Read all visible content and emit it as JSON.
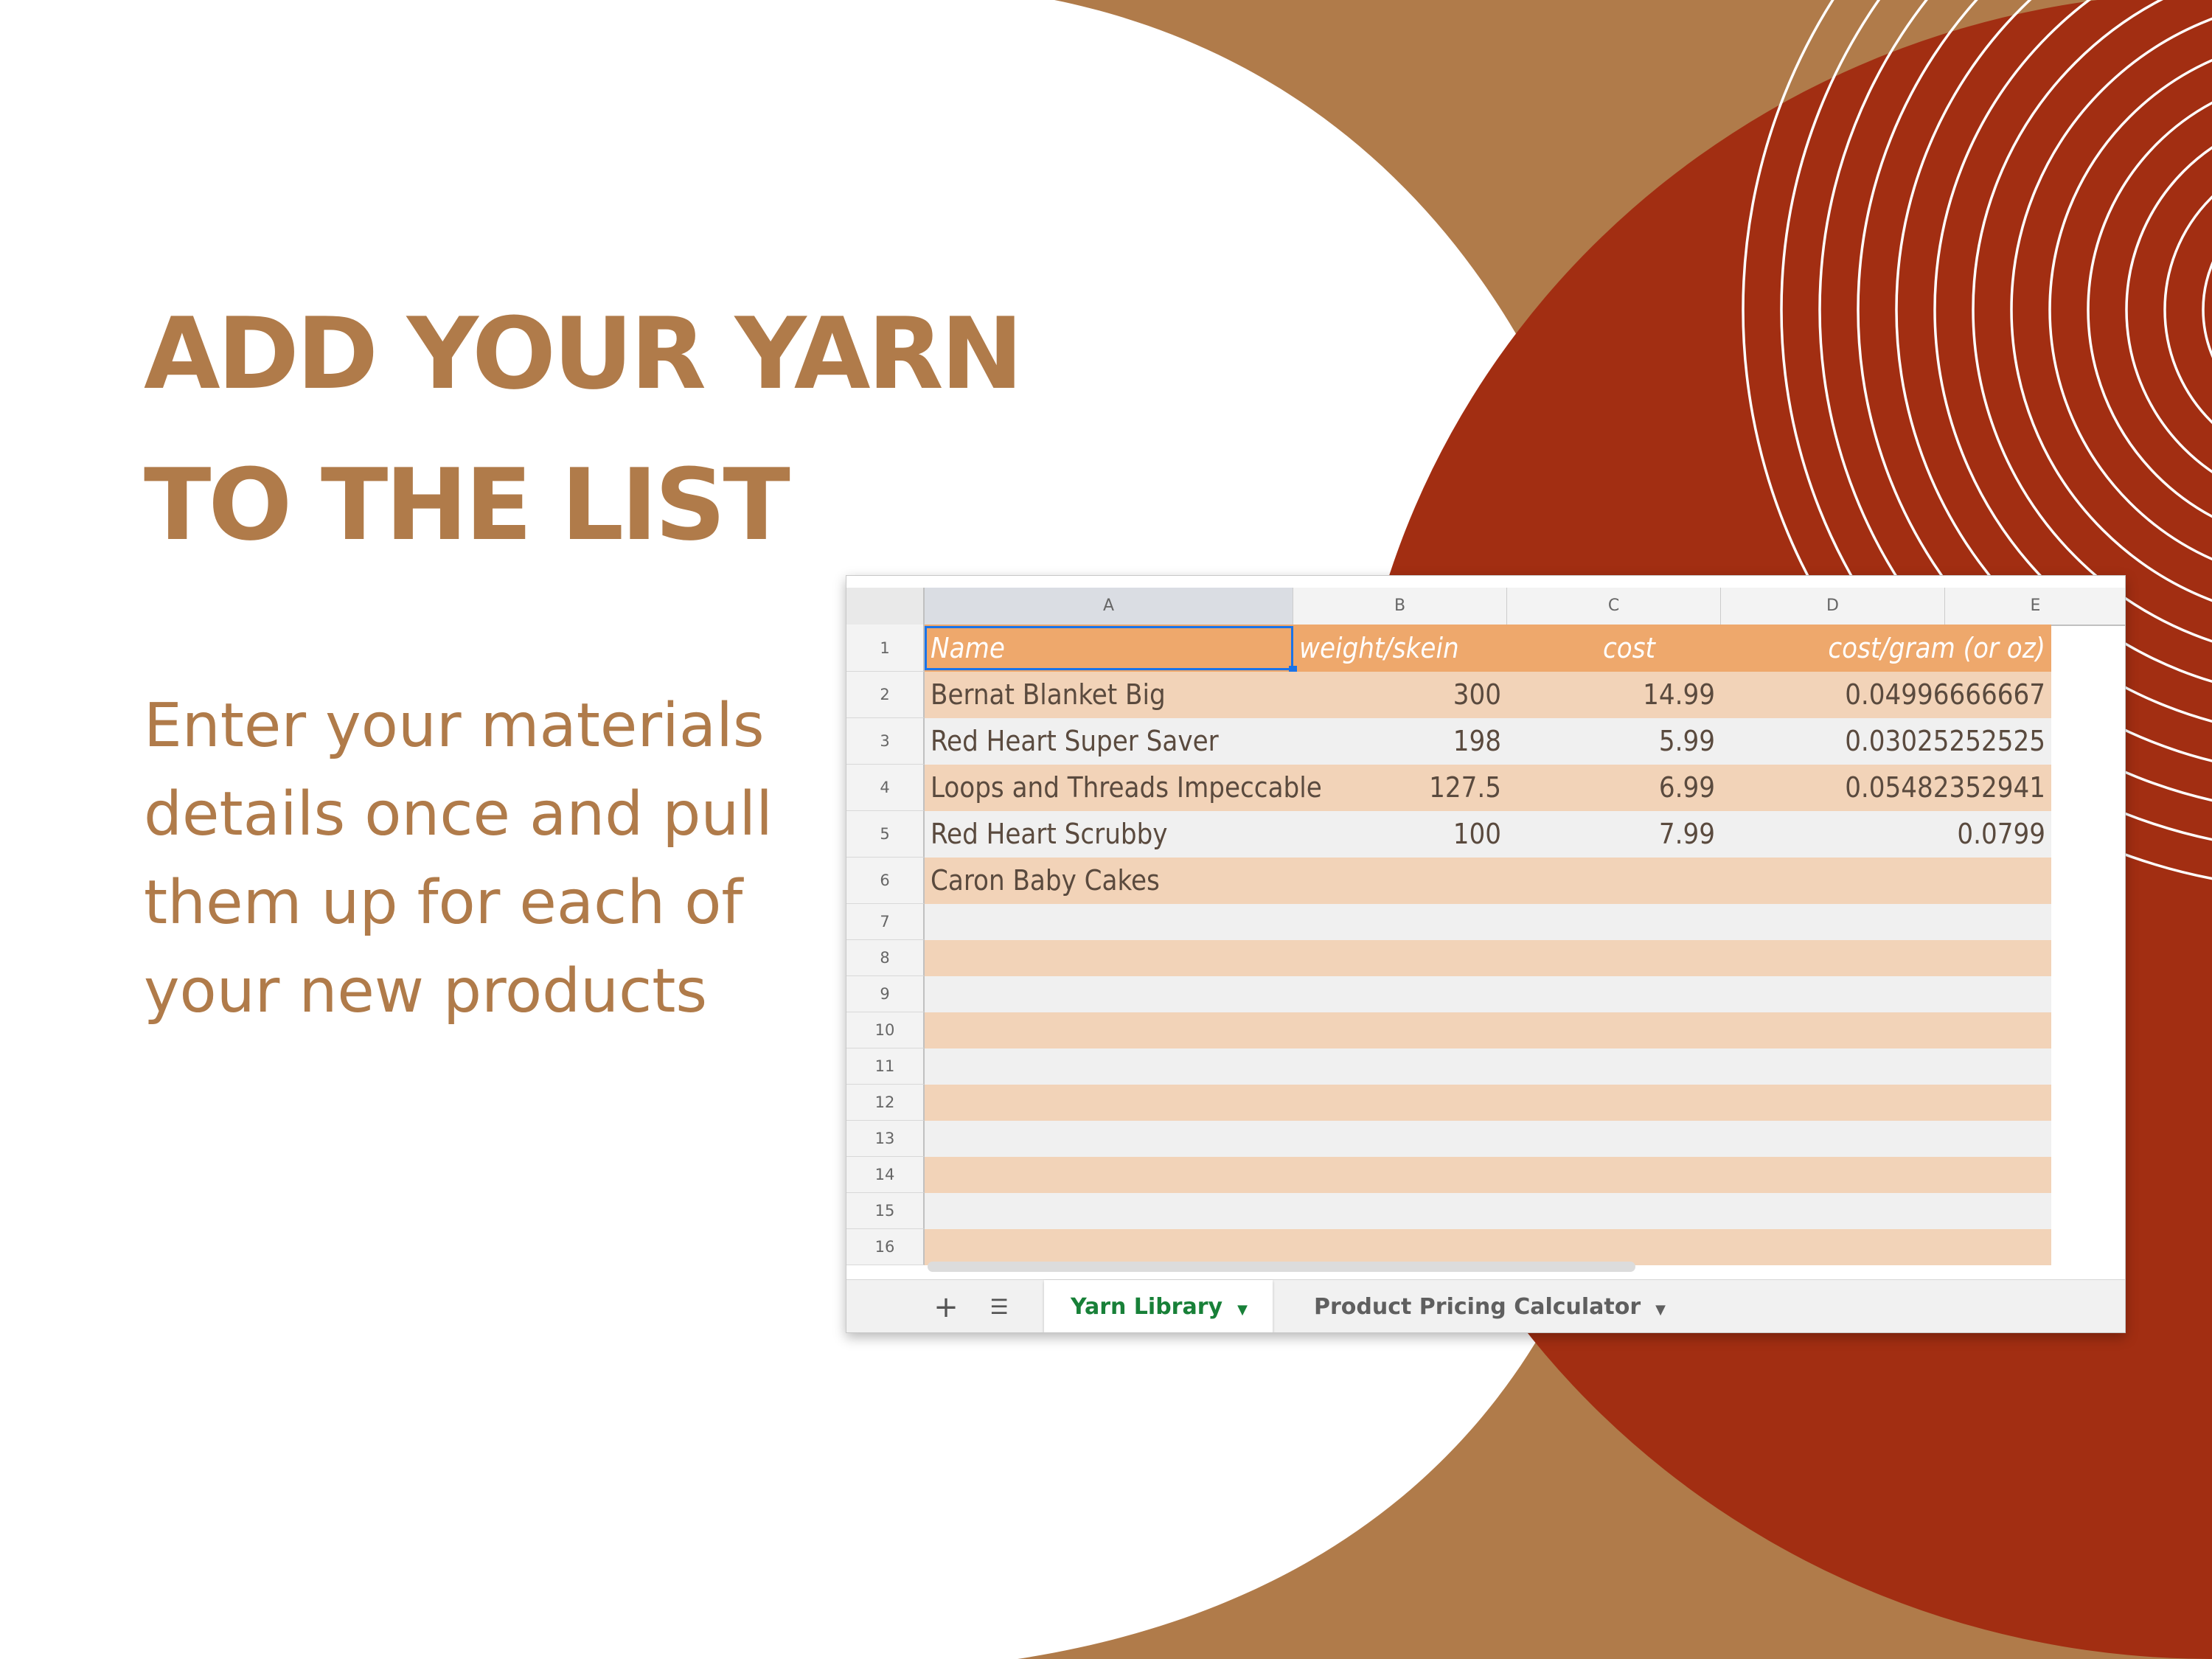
{
  "colors": {
    "accent_tan": "#b07b4a",
    "accent_rust": "#a22e12",
    "header_orange": "#eea86c",
    "band_peach": "#f2d3b8",
    "band_light": "#f0f0f0",
    "active_tab_green": "#188038"
  },
  "headline": "ADD YOUR YARN TO THE LIST",
  "body": "Enter your materials details once and pull them up for each of your new products",
  "spreadsheet": {
    "column_headers": [
      "A",
      "B",
      "C",
      "D",
      "E"
    ],
    "header_row": {
      "num": "1",
      "name": "Name",
      "weight": "weight/skein",
      "cost": "cost",
      "per": "cost/gram (or oz)"
    },
    "rows": [
      {
        "num": "2",
        "name": "Bernat Blanket Big",
        "weight": "300",
        "cost": "14.99",
        "per": "0.04996666667"
      },
      {
        "num": "3",
        "name": "Red Heart Super Saver",
        "weight": "198",
        "cost": "5.99",
        "per": "0.03025252525"
      },
      {
        "num": "4",
        "name": "Loops and Threads Impeccable",
        "weight": "127.5",
        "cost": "6.99",
        "per": "0.05482352941"
      },
      {
        "num": "5",
        "name": "Red Heart Scrubby",
        "weight": "100",
        "cost": "7.99",
        "per": "0.0799"
      },
      {
        "num": "6",
        "name": "Caron Baby Cakes",
        "weight": "",
        "cost": "",
        "per": ""
      }
    ],
    "empty_rows": [
      "7",
      "8",
      "9",
      "10",
      "11",
      "12",
      "13",
      "14",
      "15",
      "16"
    ],
    "tabs": {
      "add_icon": "plus-icon",
      "list_icon": "sheet-list-icon",
      "active": "Yarn Library",
      "inactive": "Product Pricing Calculator",
      "dropdown_icon": "caret-down-icon"
    }
  }
}
